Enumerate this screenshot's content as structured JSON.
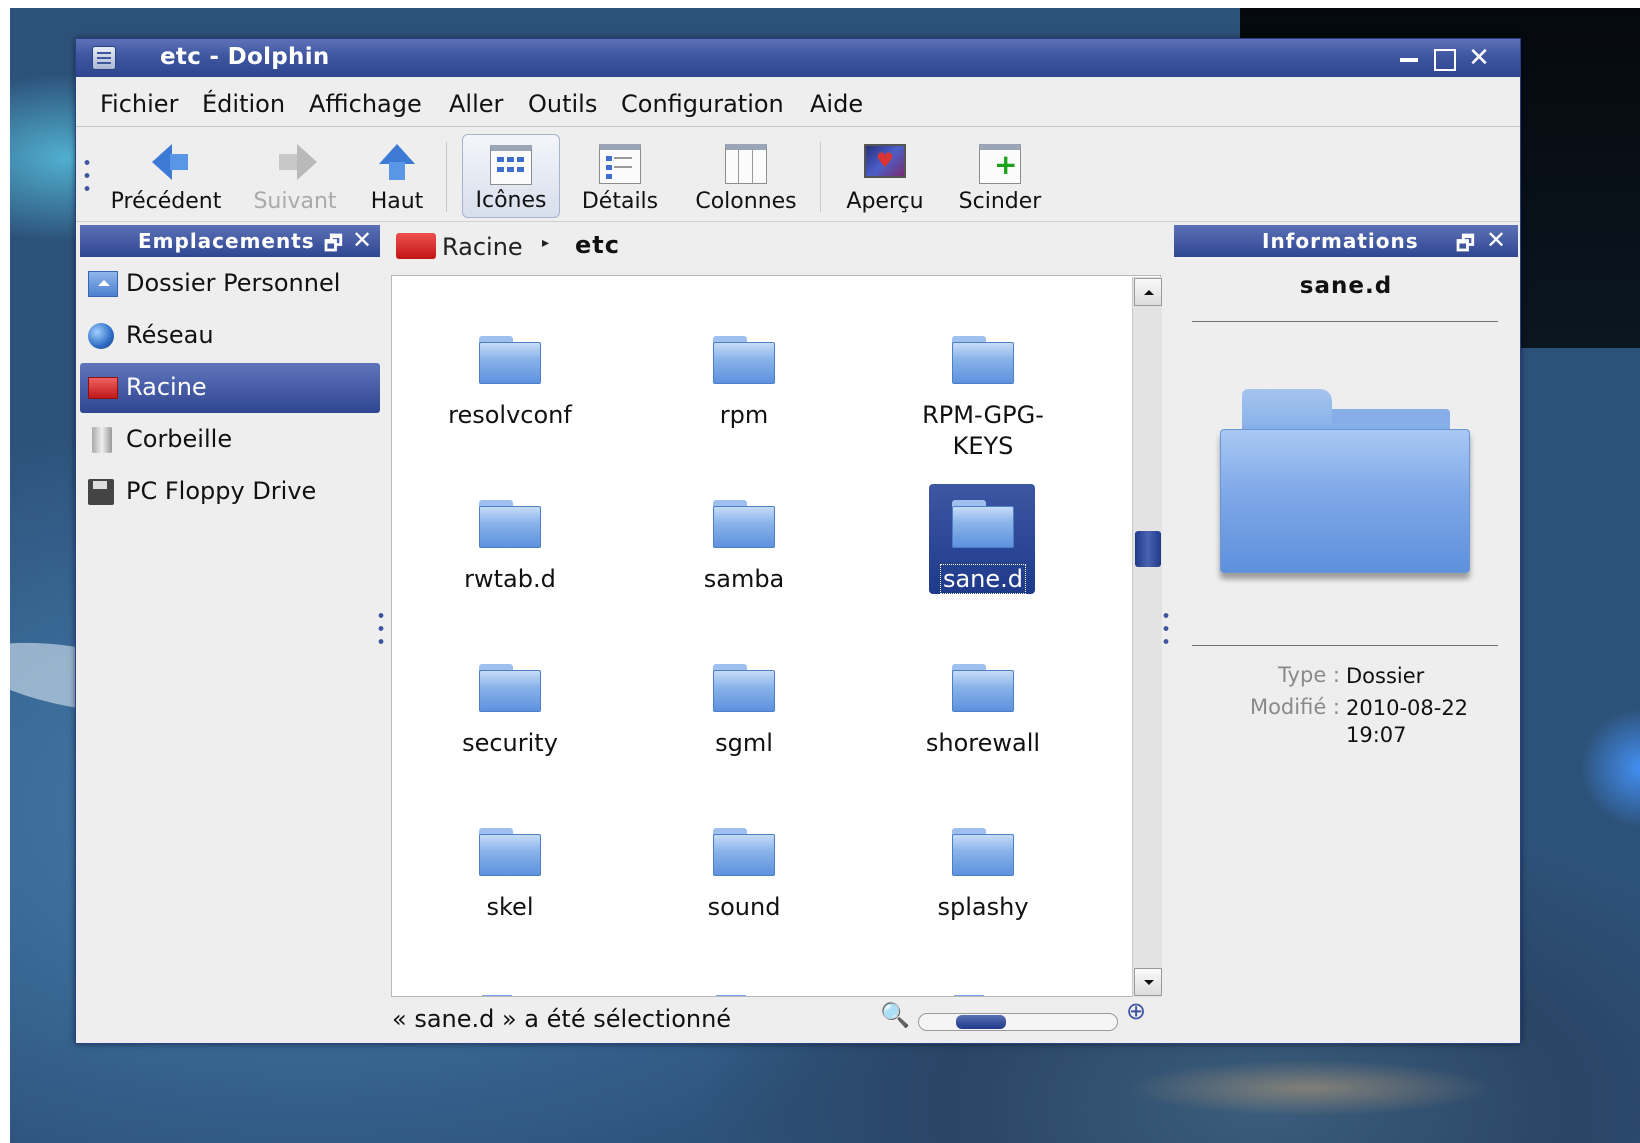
{
  "window": {
    "title": "etc - Dolphin"
  },
  "menu": [
    {
      "label": "Fichier"
    },
    {
      "label": "Édition"
    },
    {
      "label": "Affichage"
    },
    {
      "label": "Aller"
    },
    {
      "label": "Outils"
    },
    {
      "label": "Configuration"
    },
    {
      "label": "Aide"
    }
  ],
  "toolbar": {
    "back": "Précédent",
    "forward": "Suivant",
    "up": "Haut",
    "icons": "Icônes",
    "details": "Détails",
    "columns": "Colonnes",
    "preview": "Aperçu",
    "split": "Scinder"
  },
  "places": {
    "title": "Emplacements",
    "items": [
      {
        "label": "Dossier Personnel",
        "icon": "home-folder-icon"
      },
      {
        "label": "Réseau",
        "icon": "network-globe-icon"
      },
      {
        "label": "Racine",
        "icon": "root-folder-icon",
        "selected": true
      },
      {
        "label": "Corbeille",
        "icon": "trash-icon"
      },
      {
        "label": "PC Floppy Drive",
        "icon": "floppy-icon"
      }
    ]
  },
  "breadcrumb": {
    "root": "Racine",
    "current": "etc"
  },
  "files": [
    {
      "name": "resolvconf"
    },
    {
      "name": "rpm"
    },
    {
      "name": "RPM-GPG-KEYS"
    },
    {
      "name": "rwtab.d"
    },
    {
      "name": "samba"
    },
    {
      "name": "sane.d",
      "selected": true
    },
    {
      "name": "security"
    },
    {
      "name": "sgml"
    },
    {
      "name": "shorewall"
    },
    {
      "name": "skel"
    },
    {
      "name": "sound"
    },
    {
      "name": "splashy"
    }
  ],
  "status": {
    "text": "« sane.d » a été sélectionné",
    "zoom_level": 0.25
  },
  "info": {
    "title": "Informations",
    "name": "sane.d",
    "type_label": "Type :",
    "type_value": "Dossier",
    "modified_label": "Modifié :",
    "modified_value": "2010-08-22 19:07"
  },
  "colors": {
    "accent": "#2f4791",
    "folder": "#7fa8e8"
  }
}
